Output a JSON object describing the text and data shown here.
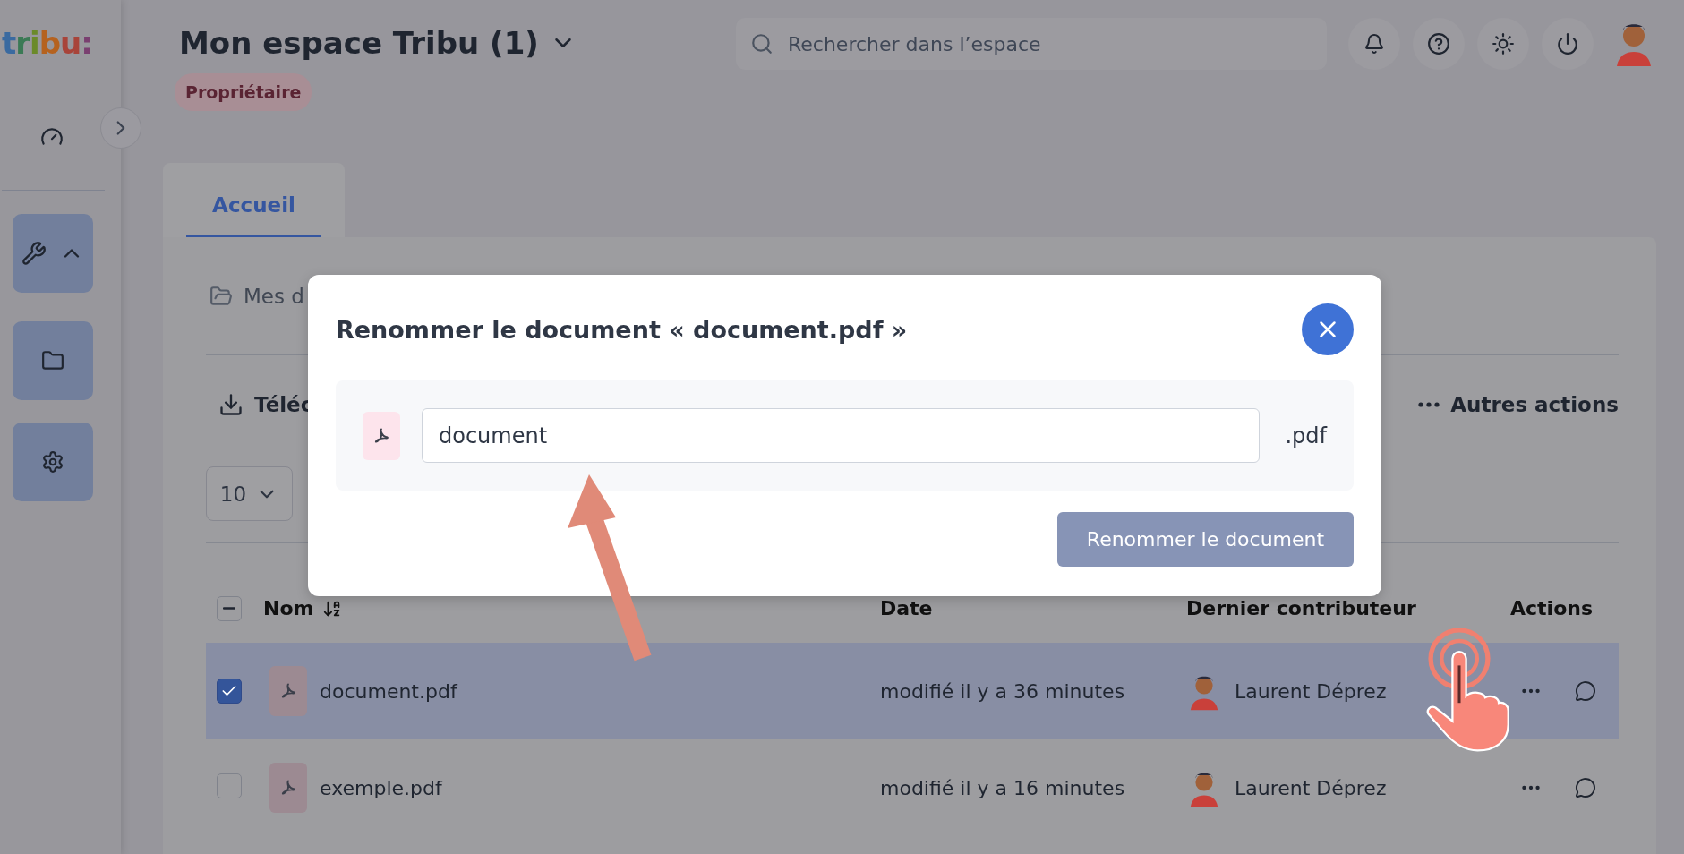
{
  "logo": {
    "text": "tribu:"
  },
  "sidebar": {
    "items": [
      {
        "kind": "dashboard"
      },
      {
        "kind": "tools",
        "expanded": true
      },
      {
        "kind": "folder"
      },
      {
        "kind": "settings"
      }
    ]
  },
  "header": {
    "title": "Mon espace Tribu (1)",
    "badge": "Propriétaire",
    "search": {
      "placeholder": "Rechercher dans l’espace"
    }
  },
  "tabs": [
    {
      "label": "Accueil",
      "selected": true
    }
  ],
  "breadcrumb": "Mes d",
  "toolbar": {
    "download": "Téléc",
    "more": "Autres actions"
  },
  "page_size": "10",
  "table": {
    "select_all": {
      "partial": true
    },
    "columns": [
      "Nom",
      "Date",
      "Dernier contributeur",
      "Actions"
    ],
    "rows": [
      {
        "name": "document.pdf",
        "date": "modifié il y a 36 minutes",
        "contributor": "Laurent Déprez",
        "selected": true
      },
      {
        "name": "exemple.pdf",
        "date": "modifié il y a 16 minutes",
        "contributor": "Laurent Déprez",
        "selected": false
      }
    ]
  },
  "modal": {
    "title": "Renommer le document « document.pdf »",
    "value": "document",
    "extension": ".pdf",
    "button": {
      "label": "Renommer le document",
      "disabled": true
    }
  }
}
